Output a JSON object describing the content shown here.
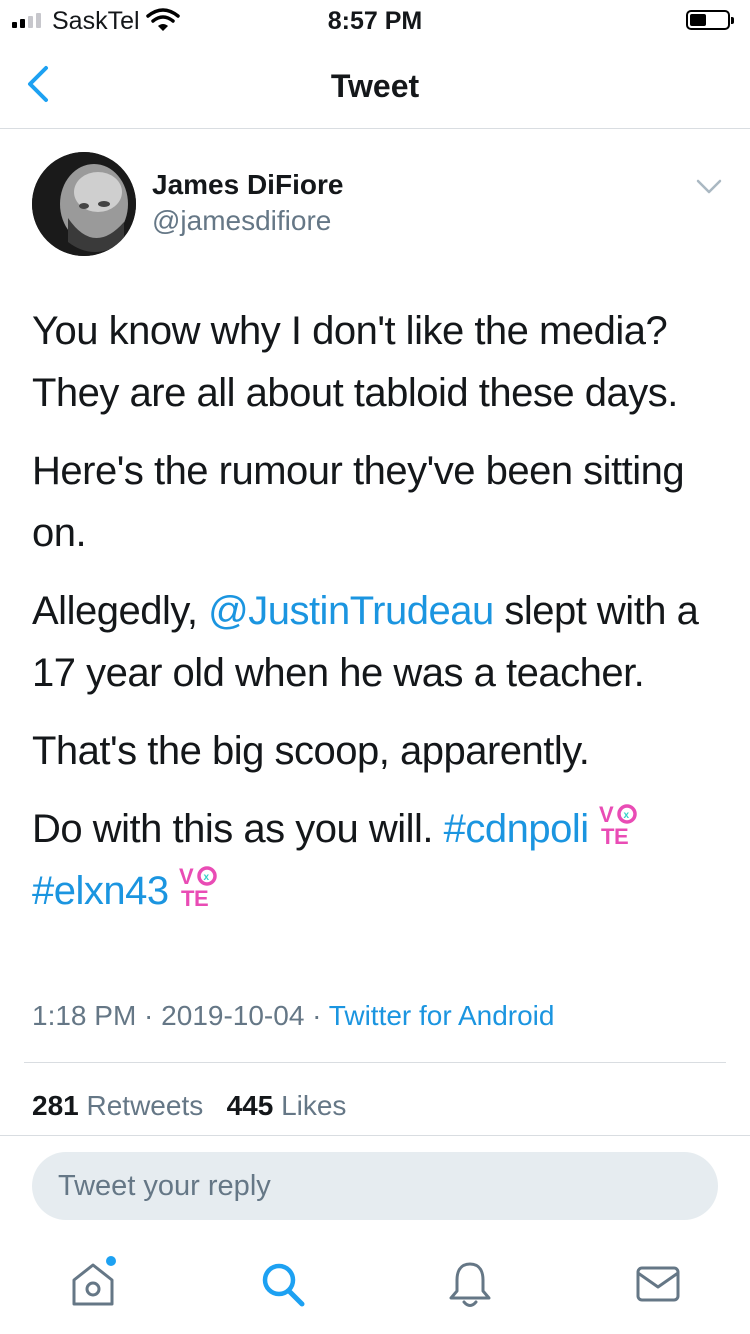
{
  "status_bar": {
    "carrier": "SaskTel",
    "time": "8:57 PM"
  },
  "header": {
    "title": "Tweet",
    "back_icon": "chevron-left-icon"
  },
  "tweet": {
    "author": {
      "name": "James DiFiore",
      "handle": "@jamesdifiore"
    },
    "paragraphs": {
      "p1": "You know why I don't like the media? They are all about tabloid these days.",
      "p2": "Here's the rumour they've been sitting on.",
      "p3_before": "Allegedly, ",
      "p3_mention": "@JustinTrudeau",
      "p3_after": " slept with a 17 year old when he was a teacher.",
      "p4": "That's the big scoop, apparently.",
      "p5_text": "Do with this as you will. ",
      "hashtags": [
        "#cdnpoli",
        "#elxn43"
      ]
    },
    "vote_emoji_lettering": "VOTE",
    "meta": {
      "time": "1:18 PM",
      "date": "2019-10-04",
      "separator": " · ",
      "source": "Twitter for Android"
    },
    "stats": {
      "retweets_count": "281",
      "retweets_label": "Retweets",
      "likes_count": "445",
      "likes_label": "Likes"
    }
  },
  "reply": {
    "placeholder": "Tweet your reply"
  },
  "tab_bar": {
    "items": [
      "home-icon",
      "search-icon",
      "notifications-icon",
      "messages-icon"
    ],
    "active": "search-icon"
  },
  "colors": {
    "link": "#1b95e0",
    "secondary_text": "#657786",
    "reply_bg": "#e6ecf0",
    "vote_pink": "#e94cb5",
    "vote_teal": "#35d1c8"
  }
}
